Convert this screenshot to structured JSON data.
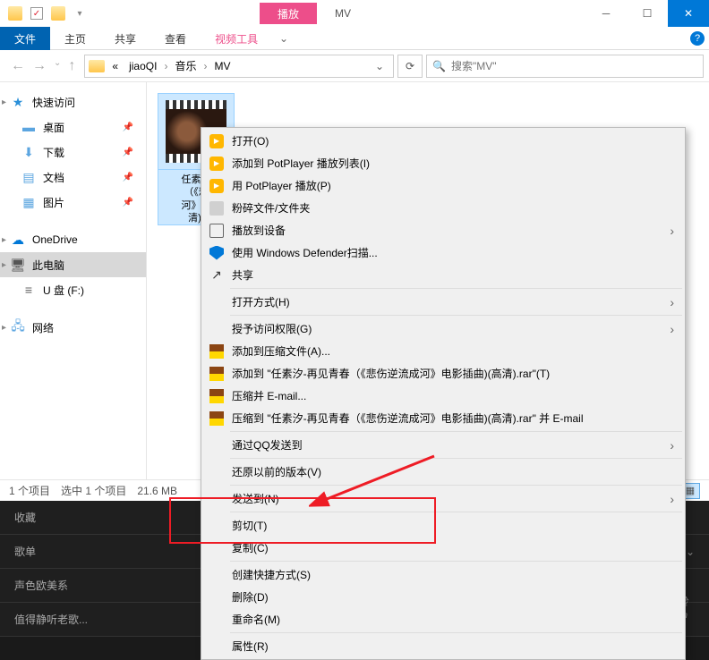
{
  "window": {
    "title": "MV",
    "tab_play": "播放",
    "ribbon": {
      "file": "文件",
      "home": "主页",
      "share": "共享",
      "view": "查看",
      "video_tools": "视频工具"
    }
  },
  "address": {
    "prefix": "«",
    "parts": [
      "jiaoQI",
      "音乐",
      "MV"
    ]
  },
  "search": {
    "placeholder": "搜索\"MV\""
  },
  "sidebar": {
    "quick_access": "快速访问",
    "desktop": "桌面",
    "downloads": "下载",
    "documents": "文档",
    "pictures": "图片",
    "onedrive": "OneDrive",
    "this_pc": "此电脑",
    "usb": "U 盘 (F:)",
    "network": "网络"
  },
  "file": {
    "name": "任素汐\n（《悲\n河》电\n清)."
  },
  "status": {
    "items": "1 个项目",
    "selected": "选中 1 个项目",
    "size": "21.6 MB"
  },
  "context_menu": {
    "open": "打开(O)",
    "add_potplayer": "添加到 PotPlayer 播放列表(I)",
    "play_potplayer": "用 PotPlayer 播放(P)",
    "shred": "粉碎文件/文件夹",
    "cast": "播放到设备",
    "defender": "使用 Windows Defender扫描...",
    "share": "共享",
    "open_with": "打开方式(H)",
    "grant_access": "授予访问权限(G)",
    "add_archive": "添加到压缩文件(A)...",
    "add_rar": "添加到 \"任素汐-再见青春（《悲伤逆流成河》电影插曲)(高清).rar\"(T)",
    "compress_email": "压缩并 E-mail...",
    "compress_rar_email": "压缩到 \"任素汐-再见青春（《悲伤逆流成河》电影插曲)(高清).rar\" 并 E-mail",
    "qq_send": "通过QQ发送到",
    "restore_versions": "还原以前的版本(V)",
    "send_to": "发送到(N)",
    "cut": "剪切(T)",
    "copy": "复制(C)",
    "shortcut": "创建快捷方式(S)",
    "delete": "删除(D)",
    "rename": "重命名(M)",
    "properties": "属性(R)"
  },
  "background": {
    "favorites": "收藏",
    "playlist": "歌单",
    "style": "声色欧美系",
    "listen": "值得静听老歌..."
  },
  "watermark": {
    "main": "Baidu 经验",
    "sub": "jingyan.baidu.com"
  }
}
